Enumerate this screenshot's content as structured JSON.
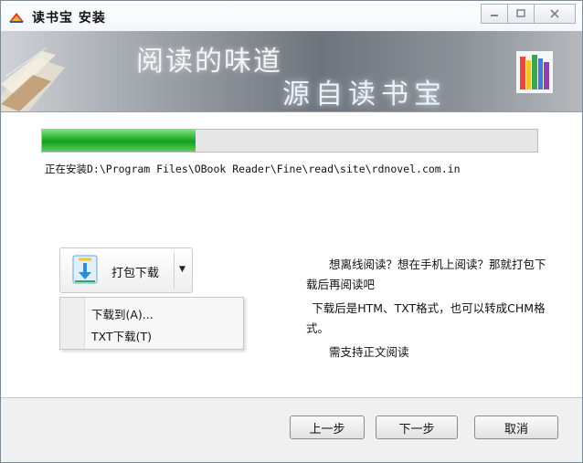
{
  "window": {
    "title": "读书宝 安装",
    "controls": [
      "minimize-icon",
      "maximize-icon",
      "close-icon"
    ]
  },
  "banner": {
    "line1": "阅读的味道",
    "line2": "源自读书宝"
  },
  "progress": {
    "fraction": 0.31,
    "status": "正在安装D:\\Program Files\\OBook Reader\\Fine\\read\\site\\rdnovel.com.in"
  },
  "download_button": {
    "label": "打包下载",
    "icon": "package-download-icon"
  },
  "menu": {
    "items": [
      {
        "label": "下载到(A)..."
      },
      {
        "label": "TXT下载(T)"
      }
    ]
  },
  "info": {
    "para1": "想离线阅读？想在手机上阅读？那就打包下载后再阅读吧",
    "para2": "下载后是HTM、TXT格式，也可以转成CHM格式。",
    "para3": "需支持正文阅读"
  },
  "buttons": {
    "back": "上一步",
    "next": "下一步",
    "cancel": "取消"
  }
}
